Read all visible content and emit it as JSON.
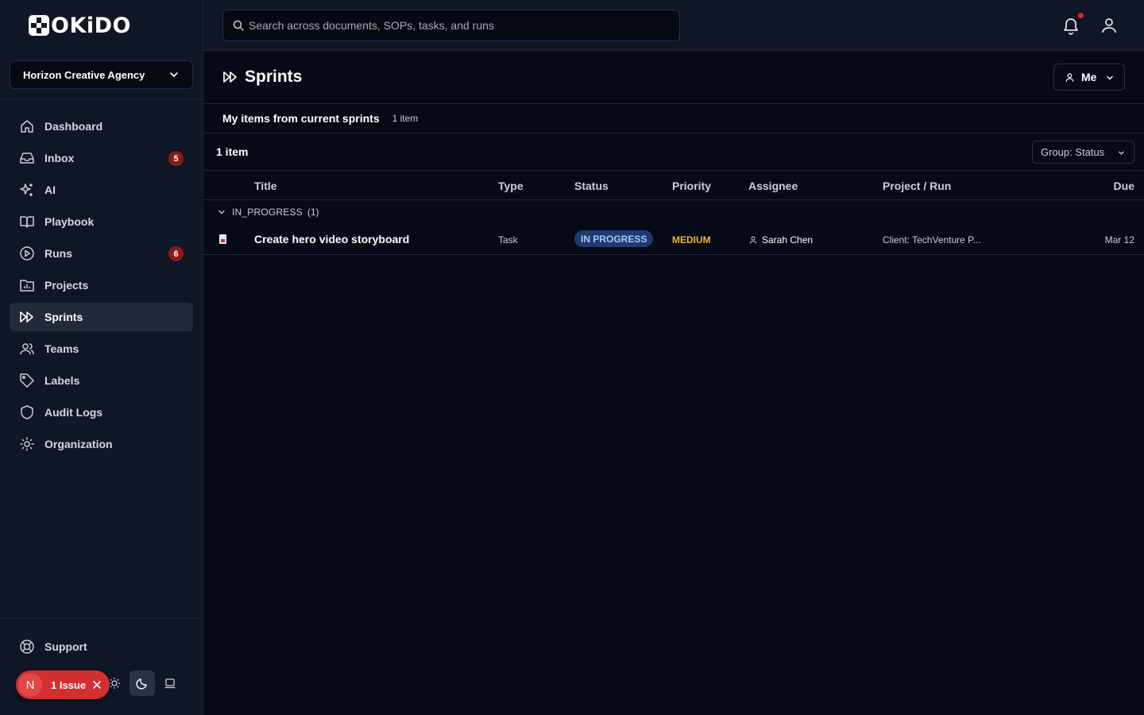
{
  "brand": {
    "logo_text": "OKiDO"
  },
  "org": {
    "selected": "Horizon Creative Agency"
  },
  "sidebar": {
    "items": [
      {
        "label": "Dashboard",
        "icon": "home-icon"
      },
      {
        "label": "Inbox",
        "icon": "inbox-icon",
        "badge": "5"
      },
      {
        "label": "AI",
        "icon": "sparkles-icon"
      },
      {
        "label": "Playbook",
        "icon": "book-icon"
      },
      {
        "label": "Runs",
        "icon": "play-circle-icon",
        "badge": "6"
      },
      {
        "label": "Projects",
        "icon": "folder-chart-icon"
      },
      {
        "label": "Sprints",
        "icon": "fast-forward-icon",
        "active": true
      },
      {
        "label": "Teams",
        "icon": "users-icon"
      },
      {
        "label": "Labels",
        "icon": "tag-icon"
      },
      {
        "label": "Audit Logs",
        "icon": "shield-icon"
      },
      {
        "label": "Organization",
        "icon": "gear-icon"
      }
    ],
    "support_label": "Support"
  },
  "issue_pill": {
    "avatar_letter": "N",
    "label": "1 Issue"
  },
  "search": {
    "placeholder": "Search across documents, SOPs, tasks, and runs",
    "value": ""
  },
  "page": {
    "title": "Sprints",
    "filter_label": "Me",
    "section_title": "My items from current sprints",
    "section_count": "1 item",
    "item_count": "1 item",
    "group_label": "Group: Status"
  },
  "table": {
    "columns": [
      "Title",
      "Type",
      "Status",
      "Priority",
      "Assignee",
      "Project / Run",
      "Due"
    ],
    "group": {
      "name": "IN_PROGRESS",
      "count": "(1)"
    },
    "rows": [
      {
        "title": "Create hero video storyboard",
        "type": "Task",
        "status": "IN PROGRESS",
        "priority": "MEDIUM",
        "assignee": "Sarah Chen",
        "project": "Client: TechVenture P...",
        "due": "Mar 12"
      }
    ]
  },
  "colors": {
    "background": "#060a17",
    "sidebar": "#0f1626",
    "badge": "#8b1a1a",
    "status_badge": "#1e3a6e",
    "priority_medium": "#f0b429",
    "issue_pill": "#d32f2f"
  }
}
